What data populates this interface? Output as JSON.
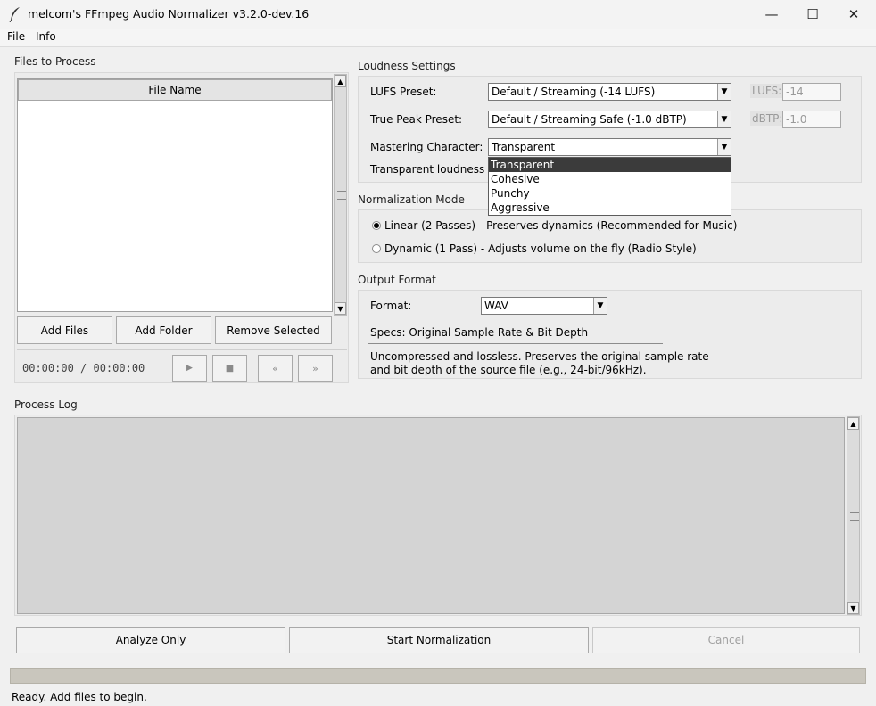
{
  "window": {
    "title": "melcom's FFmpeg Audio Normalizer v3.2.0-dev.16",
    "minimize": "—",
    "maximize": "☐",
    "close": "✕"
  },
  "menubar": {
    "file": "File",
    "info": "Info"
  },
  "files_panel": {
    "title": "Files to Process",
    "column_header": "File Name",
    "add_files": "Add Files",
    "add_folder": "Add Folder",
    "remove_selected": "Remove Selected",
    "time": "00:00:00 / 00:00:00",
    "play": "▶",
    "stop": "■",
    "prev": "«",
    "next": "»"
  },
  "loudness": {
    "title": "Loudness Settings",
    "lufs_label": "LUFS Preset:",
    "lufs_value": "Default / Streaming (-14 LUFS)",
    "lufs_field_label": "LUFS:",
    "lufs_field_value": "-14",
    "tp_label": "True Peak Preset:",
    "tp_value": "Default / Streaming Safe (-1.0 dBTP)",
    "tp_field_label": "dBTP:",
    "tp_field_value": "-1.0",
    "mastering_label": "Mastering Character:",
    "mastering_value": "Transparent",
    "description": "Transparent loudness no",
    "options": [
      "Transparent",
      "Cohesive",
      "Punchy",
      "Aggressive"
    ],
    "selected_option": "Transparent"
  },
  "normalization": {
    "title": "Normalization Mode",
    "linear": "Linear (2 Passes) - Preserves dynamics (Recommended for Music)",
    "dynamic": "Dynamic (1 Pass) - Adjusts volume on the fly (Radio Style)",
    "selected": "linear"
  },
  "output": {
    "title": "Output Format",
    "format_label": "Format:",
    "format_value": "WAV",
    "specs": "Specs: Original Sample Rate & Bit Depth",
    "desc_line1": "Uncompressed and lossless. Preserves the original sample rate",
    "desc_line2": "and bit depth of the source file (e.g., 24-bit/96kHz)."
  },
  "log": {
    "title": "Process Log"
  },
  "actions": {
    "analyze": "Analyze Only",
    "start": "Start Normalization",
    "cancel": "Cancel"
  },
  "status": {
    "text": "Ready. Add files to begin.",
    "progress": 0
  }
}
